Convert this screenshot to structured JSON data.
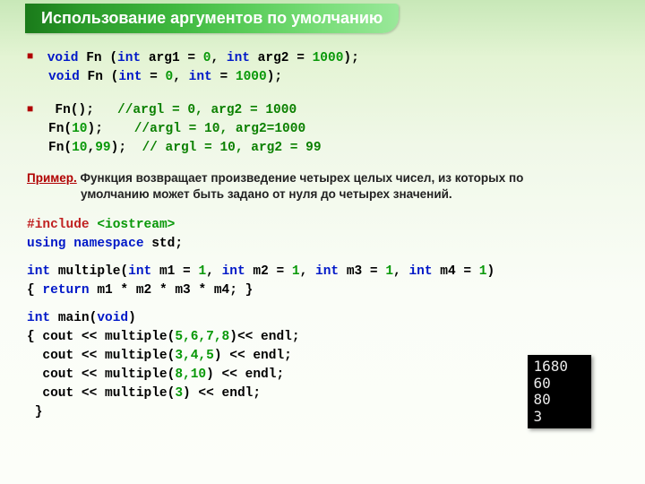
{
  "title": "Использование аргументов по умолчанию",
  "sig1": {
    "void": "void",
    "fn": "Fn",
    "open": " (",
    "int": "int",
    "a1": " arg1 = ",
    "z": "0",
    "c": ", ",
    "a2": " arg2 = ",
    "th": "1000",
    "close": ");"
  },
  "sig2": {
    "void": "void",
    "fn": "Fn",
    "open": " (",
    "int": "int",
    "a1": " = ",
    "z": "0",
    "c": ", ",
    "a2": " = ",
    "th": "1000",
    "close": ");"
  },
  "call1": {
    "fn": "Fn();   ",
    "cm": "//argl = 0, arg2 = 1000"
  },
  "call2": {
    "a": "Fn(",
    "n1": "10",
    "b": ");    ",
    "cm": "//argl = 10, arg2=1000"
  },
  "call3": {
    "a": "Fn(",
    "n1": "10",
    "c": ",",
    "n2": "99",
    "b": ");  ",
    "cm": "// argl = 10, arg2 = 99"
  },
  "note": {
    "lead": "Пример.",
    "body": " Функция возвращает произведение четырех целых чисел, из которых по",
    "body2": "умолчанию может быть задано от нуля до четырех значений."
  },
  "inc": {
    "hash": "#include ",
    "hdr": "<iostream>"
  },
  "usingL": "using namespace ",
  "std": "std;",
  "mulDecl": {
    "int": "int ",
    "name": "multiple(",
    "p1": "int",
    "m1": " m1 = ",
    "one": "1",
    "c": ", ",
    "m2": " m2 = ",
    "m3": " m3 = ",
    "m4": " m4 = ",
    "close": ")"
  },
  "mulBody": {
    "open": "{ ",
    "ret": "return",
    "expr": " m1 * m2 * m3 * m4; }"
  },
  "mainDecl": {
    "int": "int ",
    "name": "main(",
    "void": "void",
    "close": ")"
  },
  "cout1": {
    "a": "{ cout << multiple(",
    "n": "5,6,7,8",
    "b": ")<< endl;"
  },
  "cout2": {
    "a": "  cout << multiple(",
    "n": "3,4,5",
    "b": ") << endl;"
  },
  "cout3": {
    "a": "  cout << multiple(",
    "n": "8,10",
    "b": ") << endl;"
  },
  "cout4": {
    "a": "  cout << multiple(",
    "n": "3",
    "b": ") << endl;"
  },
  "closeBrace": " }",
  "output": {
    "l1": "1680",
    "l2": "60",
    "l3": "80",
    "l4": "3"
  }
}
